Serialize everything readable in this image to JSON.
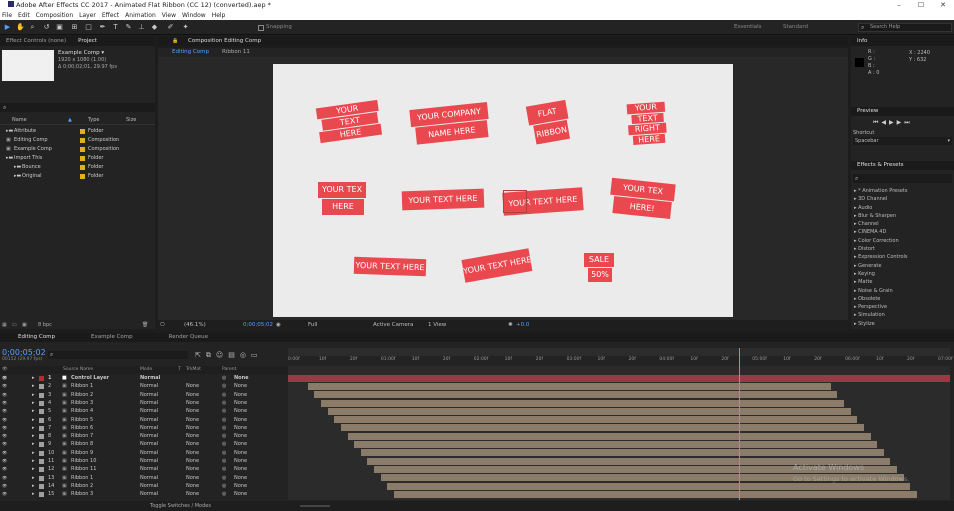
{
  "window": {
    "title": "Adobe After Effects CC 2017 - Animated Flat Ribbon (CC 12) (converted).aep *",
    "minimize": "–",
    "maximize": "☐",
    "close": "✕"
  },
  "menu": [
    "File",
    "Edit",
    "Composition",
    "Layer",
    "Effect",
    "Animation",
    "View",
    "Window",
    "Help"
  ],
  "toolbar": {
    "snapping": "Snapping",
    "workspace1": "Essentials",
    "workspace2": "Standard",
    "search_placeholder": "Search Help"
  },
  "project": {
    "tab_effect_controls": "Effect Controls (none)",
    "tab_project": "Project",
    "comp_name": "Example Comp ▾",
    "comp_info1": "1920 x 1080 (1.00)",
    "comp_info2": "Δ 0;00;02;01, 29.97 fps",
    "col_name": "Name",
    "col_type": "Type",
    "col_size": "Size",
    "items": [
      {
        "name": "Attribute",
        "type": "Folder",
        "label": "#e0b020"
      },
      {
        "name": "Editing Comp",
        "type": "Composition",
        "label": "#e0b020"
      },
      {
        "name": "Example Comp",
        "type": "Composition",
        "label": "#e0b020"
      },
      {
        "name": "Import This",
        "type": "Folder",
        "label": "#e0b020"
      },
      {
        "name": "Bounce",
        "type": "Folder",
        "label": "#e0b020"
      },
      {
        "name": "Original",
        "type": "Folder",
        "label": "#e0b020"
      }
    ],
    "bpc": "8 bpc"
  },
  "comp": {
    "tab": "Composition Editing Comp",
    "sub1": "Editing Comp",
    "sub2": "Ribbon 11",
    "zoom": "(46.1%)",
    "time": "0;00;05;02",
    "res": "Full",
    "camera": "Active Camera",
    "view": "1 View",
    "exposure": "+0.0"
  },
  "ribbons": [
    {
      "lines": [
        "YOUR",
        "TEXT",
        "HERE"
      ]
    },
    {
      "lines": [
        "YOUR COMPANY",
        "NAME HERE"
      ]
    },
    {
      "lines": [
        "FLAT",
        "RIBBON"
      ]
    },
    {
      "lines": [
        "YOUR",
        "TEXT",
        "RIGHT",
        "HERE"
      ]
    },
    {
      "lines": [
        "YOUR TEX",
        "HERE"
      ]
    },
    {
      "lines": [
        "YOUR TEXT HERE"
      ]
    },
    {
      "lines": [
        "YOUR TEXT HERE"
      ]
    },
    {
      "lines": [
        "YOUR TEX",
        "HERE!"
      ]
    },
    {
      "lines": [
        "YOUR TEXT HERE"
      ]
    },
    {
      "lines": [
        "YOUR TEXT HERE"
      ]
    },
    {
      "lines": [
        "SALE",
        "50%"
      ]
    }
  ],
  "info": {
    "tab": "Info",
    "r": "R :",
    "g": "G :",
    "b": "B :",
    "a": "A : 0",
    "x": "X : 2240",
    "y": "Y : 632"
  },
  "preview": {
    "tab": "Preview",
    "shortcut_label": "Shortcut",
    "shortcut_value": "Spacebar"
  },
  "effects": {
    "tab": "Effects & Presets",
    "items": [
      "* Animation Presets",
      "3D Channel",
      "Audio",
      "Blur & Sharpen",
      "Channel",
      "CINEMA 4D",
      "Color Correction",
      "Distort",
      "Expression Controls",
      "Generate",
      "Keying",
      "Matte",
      "Noise & Grain",
      "Obsolete",
      "Perspective",
      "Simulation",
      "Stylize"
    ]
  },
  "timeline": {
    "tabs": [
      "Editing Comp",
      "Example Comp",
      "Render Queue"
    ],
    "time": "0;00;05;02",
    "fps": "00152 (29.97 fps)",
    "col_source": "Source Name",
    "col_mode": "Mode",
    "col_t": "T",
    "col_trkmat": "TrkMat",
    "col_parent": "Parent",
    "toggle": "Toggle Switches / Modes",
    "ruler": [
      "0:00f",
      "10f",
      "20f",
      "01:00f",
      "10f",
      "20f",
      "02:00f",
      "10f",
      "20f",
      "03:00f",
      "10f",
      "20f",
      "04:00f",
      "10f",
      "20f",
      "05:00f",
      "10f",
      "20f",
      "06:00f",
      "10f",
      "20f",
      "07:00f"
    ],
    "layers": [
      {
        "num": "1",
        "name": "Control Layer",
        "mode": "Normal",
        "trk": "",
        "parent": "None",
        "end": 1.0,
        "color": "#c0c0c0"
      },
      {
        "num": "2",
        "name": "Ribbon 1",
        "mode": "Normal",
        "trk": "None",
        "parent": "None",
        "end": 0.82,
        "color": "#a0a0a0"
      },
      {
        "num": "3",
        "name": "Ribbon 2",
        "mode": "Normal",
        "trk": "None",
        "parent": "None",
        "end": 0.83,
        "color": "#a0a0a0"
      },
      {
        "num": "4",
        "name": "Ribbon 3",
        "mode": "Normal",
        "trk": "None",
        "parent": "None",
        "end": 0.84,
        "color": "#a0a0a0"
      },
      {
        "num": "5",
        "name": "Ribbon 4",
        "mode": "Normal",
        "trk": "None",
        "parent": "None",
        "end": 0.85,
        "color": "#a0a0a0"
      },
      {
        "num": "6",
        "name": "Ribbon 5",
        "mode": "Normal",
        "trk": "None",
        "parent": "None",
        "end": 0.86,
        "color": "#a0a0a0"
      },
      {
        "num": "7",
        "name": "Ribbon 6",
        "mode": "Normal",
        "trk": "None",
        "parent": "None",
        "end": 0.87,
        "color": "#a0a0a0"
      },
      {
        "num": "8",
        "name": "Ribbon 7",
        "mode": "Normal",
        "trk": "None",
        "parent": "None",
        "end": 0.88,
        "color": "#a0a0a0"
      },
      {
        "num": "9",
        "name": "Ribbon 8",
        "mode": "Normal",
        "trk": "None",
        "parent": "None",
        "end": 0.89,
        "color": "#a0a0a0"
      },
      {
        "num": "10",
        "name": "Ribbon 9",
        "mode": "Normal",
        "trk": "None",
        "parent": "None",
        "end": 0.9,
        "color": "#a0a0a0"
      },
      {
        "num": "11",
        "name": "Ribbon 10",
        "mode": "Normal",
        "trk": "None",
        "parent": "None",
        "end": 0.91,
        "color": "#a0a0a0"
      },
      {
        "num": "12",
        "name": "Ribbon 11",
        "mode": "Normal",
        "trk": "None",
        "parent": "None",
        "end": 0.92,
        "color": "#a0a0a0"
      },
      {
        "num": "13",
        "name": "Ribbon 1",
        "mode": "Normal",
        "trk": "None",
        "parent": "None",
        "end": 0.93,
        "color": "#a0a0a0"
      },
      {
        "num": "14",
        "name": "Ribbon 2",
        "mode": "Normal",
        "trk": "None",
        "parent": "None",
        "end": 0.94,
        "color": "#a0a0a0"
      },
      {
        "num": "15",
        "name": "Ribbon 3",
        "mode": "Normal",
        "trk": "None",
        "parent": "None",
        "end": 0.95,
        "color": "#a0a0a0"
      }
    ]
  },
  "watermark": {
    "line1": "Activate Windows",
    "line2": "Go to Settings to activate Windows."
  }
}
